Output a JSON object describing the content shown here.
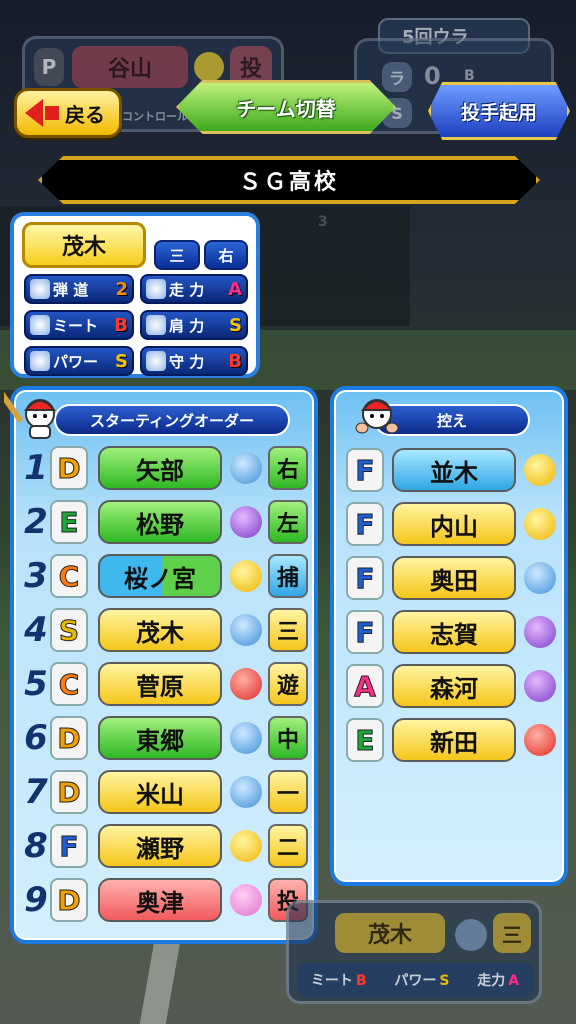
{
  "background": {
    "pitcher_tag": "P",
    "pitcher_name": "谷山",
    "pitcher_role": "投",
    "control_text": "コントロール",
    "inning": "5回ウラ",
    "bases_label": "ラ",
    "score": "0",
    "count_label": "B",
    "s_label": "S",
    "batter_order_hint": "3"
  },
  "top": {
    "back_label": "戻る",
    "team_switch_label": "チーム切替",
    "pitcher_button_label": "投手起用",
    "school_name": "ＳＧ高校"
  },
  "player_card": {
    "name": "茂木",
    "position": "三",
    "handedness": "右",
    "stats": [
      {
        "label": "弾 道",
        "value": "2",
        "icon": "bat-trajectory-icon",
        "color": "#f28a1a"
      },
      {
        "label": "走 力",
        "value": "A",
        "icon": "run-icon",
        "color": "#ff2d8a"
      },
      {
        "label": "ミート",
        "value": "B",
        "icon": "meet-icon",
        "color": "#ff3a2a"
      },
      {
        "label": "肩 力",
        "value": "S",
        "icon": "throw-icon",
        "color": "#f5c400"
      },
      {
        "label": "パワー",
        "value": "S",
        "icon": "power-icon",
        "color": "#f5c400"
      },
      {
        "label": "守 力",
        "value": "B",
        "icon": "glove-icon",
        "color": "#ff3a2a"
      }
    ]
  },
  "starting": {
    "title": "スターティングオーダー",
    "rows": [
      {
        "num": "1",
        "rank": "D",
        "name": "矢部",
        "name_color": "green",
        "face": "blue-sad",
        "pos": "右",
        "pos_color": "green"
      },
      {
        "num": "2",
        "rank": "E",
        "name": "松野",
        "name_color": "green",
        "face": "purple-angry",
        "pos": "左",
        "pos_color": "green"
      },
      {
        "num": "3",
        "rank": "C",
        "name": "桜ノ宮",
        "name_color": "blue-green",
        "face": "yellow-neutral",
        "pos": "捕",
        "pos_color": "blue"
      },
      {
        "num": "4",
        "rank": "S",
        "name": "茂木",
        "name_color": "yellow",
        "face": "blue-sad",
        "pos": "三",
        "pos_color": "yellow"
      },
      {
        "num": "5",
        "rank": "C",
        "name": "菅原",
        "name_color": "yellow",
        "face": "red-happy",
        "pos": "遊",
        "pos_color": "yellow"
      },
      {
        "num": "6",
        "rank": "D",
        "name": "東郷",
        "name_color": "green",
        "face": "blue-sad",
        "pos": "中",
        "pos_color": "green"
      },
      {
        "num": "7",
        "rank": "D",
        "name": "米山",
        "name_color": "yellow",
        "face": "blue-sad",
        "pos": "一",
        "pos_color": "yellow"
      },
      {
        "num": "8",
        "rank": "F",
        "name": "瀬野",
        "name_color": "yellow",
        "face": "yellow-neutral",
        "pos": "二",
        "pos_color": "yellow"
      },
      {
        "num": "9",
        "rank": "D",
        "name": "奥津",
        "name_color": "red",
        "face": "pink-tired",
        "pos": "投",
        "pos_color": "red"
      }
    ]
  },
  "bench": {
    "title": "控え",
    "rows": [
      {
        "rank": "F",
        "name": "並木",
        "name_color": "blue",
        "face": "yellow-neutral"
      },
      {
        "rank": "F",
        "name": "内山",
        "name_color": "yellow",
        "face": "yellow-neutral"
      },
      {
        "rank": "F",
        "name": "奥田",
        "name_color": "yellow",
        "face": "blue-sad"
      },
      {
        "rank": "F",
        "name": "志賀",
        "name_color": "yellow",
        "face": "purple-angry"
      },
      {
        "rank": "A",
        "name": "森河",
        "name_color": "yellow",
        "face": "purple-angry"
      },
      {
        "rank": "E",
        "name": "新田",
        "name_color": "yellow",
        "face": "red-happy"
      }
    ]
  },
  "bottom_preview": {
    "name": "茂木",
    "pos": "三",
    "stats": [
      {
        "label": "ミート",
        "value": "B"
      },
      {
        "label": "パワー",
        "value": "S"
      },
      {
        "label": "走力",
        "value": "A"
      }
    ]
  },
  "colors": {
    "rank": {
      "S": "#e6b800",
      "A": "#ff2d8a",
      "B": "#ff3a2a",
      "C": "#ff7a10",
      "D": "#f0a000",
      "E": "#1fa83a",
      "F": "#1e5fd8"
    }
  }
}
